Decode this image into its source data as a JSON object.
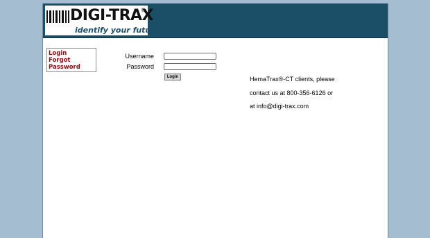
{
  "header": {
    "logo_text": "DIGI-TRAX",
    "logo_reg": "®",
    "tagline": "identify your future"
  },
  "sidenav": {
    "items": [
      {
        "label": "Login"
      },
      {
        "label": "Forgot"
      },
      {
        "label": "Password"
      }
    ]
  },
  "login_form": {
    "username_label": "Username",
    "username_value": "",
    "password_label": "Password",
    "password_value": "",
    "submit_label": "Login"
  },
  "info": {
    "line1": "HemaTrax®-CT clients, please",
    "line2": "contact us at 800-356-6126 or",
    "line3": "at info@digi-trax.com"
  },
  "colors": {
    "background": "#a4bdd0",
    "header": "#1b4e67",
    "nav_link": "#8b0f0f"
  }
}
